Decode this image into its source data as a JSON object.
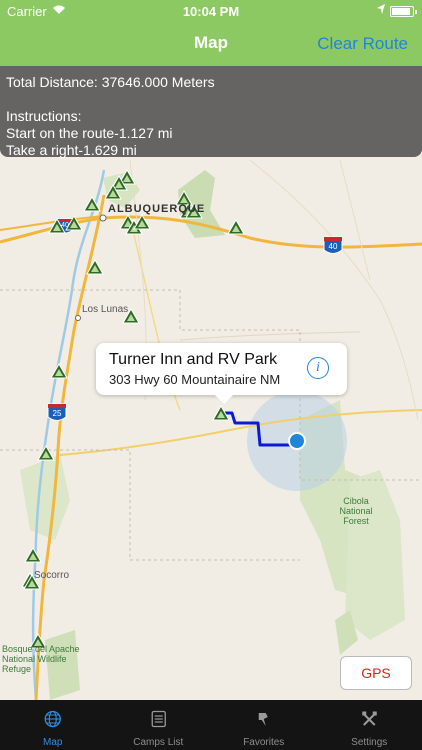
{
  "status_bar": {
    "carrier": "Carrier",
    "time": "10:04 PM"
  },
  "nav": {
    "title": "Map",
    "clear_route_label": "Clear Route"
  },
  "instructions": {
    "total_distance": "Total Distance: 37646.000 Meters",
    "heading": "Instructions:",
    "steps": [
      "Start on the route-1.127 mi",
      "Take a right-1.629 mi"
    ]
  },
  "map": {
    "labels": {
      "albuquerque": "ALBUQUERQUE",
      "los_lunas": "Los Lunas",
      "socorro": "Socorro",
      "cibola": "Cibola National Forest",
      "bosque": "Bosque del Apache National Wildlife Refuge",
      "interstate_40": "40",
      "interstate_25": "25",
      "interstate_shield_top": "40"
    },
    "callout": {
      "title": "Turner Inn and RV Park",
      "subtitle": "303 Hwy 60 Mountainaire NM"
    },
    "gps_label": "GPS",
    "colors": {
      "route": "#0a1bd6",
      "user_location": "#1f86d9",
      "campsite_marker": "#2e6b27"
    }
  },
  "tabs": [
    {
      "label": "Map",
      "icon": "globe-icon",
      "active": true
    },
    {
      "label": "Camps List",
      "icon": "list-icon",
      "active": false
    },
    {
      "label": "Favorites",
      "icon": "pin-icon",
      "active": false
    },
    {
      "label": "Settings",
      "icon": "tools-icon",
      "active": false
    }
  ]
}
